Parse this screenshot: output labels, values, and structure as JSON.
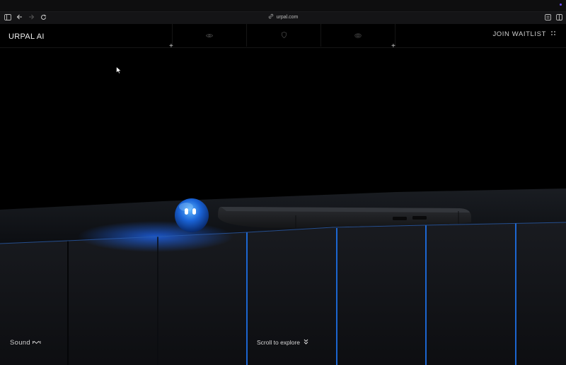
{
  "browser": {
    "url": "urpal.com",
    "icons": [
      "sidebar-toggle-icon",
      "back-icon",
      "forward-icon",
      "reload-icon",
      "link-icon",
      "reader-icon",
      "split-view-icon"
    ]
  },
  "nav": {
    "logo": "URPAL AI",
    "join_label": "JOIN WAITLIST",
    "icons": [
      "eye-icon",
      "shield-icon",
      "lens-icon"
    ]
  },
  "footer": {
    "sound_label": "Sound",
    "scroll_label": "Scroll to explore"
  },
  "colors": {
    "background": "#000000",
    "accent_glow": "#1f7bff",
    "text": "#e6e6e6"
  }
}
